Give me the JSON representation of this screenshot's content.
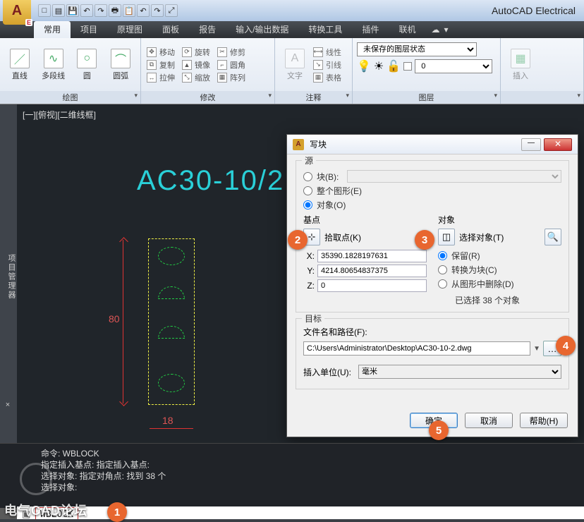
{
  "app": {
    "title": "AutoCAD Electrical"
  },
  "qat": [
    "□",
    "▦",
    "🖫",
    "↶",
    "↷",
    "🖶",
    "🗋",
    "↶",
    "↷",
    "⤢"
  ],
  "tabs": {
    "items": [
      "常用",
      "项目",
      "原理图",
      "面板",
      "报告",
      "输入/输出数据",
      "转换工具",
      "插件",
      "联机"
    ],
    "active_index": 0
  },
  "ribbon": {
    "draw": {
      "label": "绘图",
      "btns": [
        "直线",
        "多段线",
        "圆",
        "圆弧"
      ]
    },
    "modify": {
      "label": "修改",
      "items": [
        "移动",
        "旋转",
        "修剪",
        "复制",
        "镜像",
        "圆角",
        "拉伸",
        "缩放",
        "阵列"
      ]
    },
    "annot": {
      "label": "注释",
      "text_btn": "文字",
      "items": [
        "线性",
        "引线",
        "表格"
      ]
    },
    "layer": {
      "label": "图层",
      "state_label": "未保存的图层状态",
      "current": "0"
    },
    "insert": {
      "label": "插入"
    }
  },
  "canvas": {
    "view_label": "[一][俯视][二维线框]",
    "part_text": "AC30-10/2",
    "dim_v": "80",
    "dim_h": "18"
  },
  "sidebar": {
    "label": "项目管理器"
  },
  "dialog": {
    "title": "写块",
    "source": {
      "group": "源",
      "block": "块(B):",
      "entire": "整个图形(E)",
      "objects": "对象(O)"
    },
    "basepoint": {
      "group": "基点",
      "pick": "拾取点(K)",
      "x_label": "X:",
      "x": "35390.1828197631",
      "y_label": "Y:",
      "y": "4214.80654837375",
      "z_label": "Z:",
      "z": "0"
    },
    "objects": {
      "group": "对象",
      "select": "选择对象(T)",
      "retain": "保留(R)",
      "convert": "转换为块(C)",
      "delete": "从图形中删除(D)",
      "status": "已选择 38 个对象"
    },
    "target": {
      "group": "目标",
      "file_label": "文件名和路径(F):",
      "path": "C:\\Users\\Administrator\\Desktop\\AC30-10-2.dwg",
      "unit_label": "插入单位(U):",
      "unit": "毫米"
    },
    "buttons": {
      "ok": "确定",
      "cancel": "取消",
      "help": "帮助(H)"
    }
  },
  "command": {
    "lines": [
      "命令: WBLOCK",
      "指定插入基点: 指定插入基点:",
      "选择对象: 指定对角点: 找到 38 个",
      "选择对象:"
    ],
    "input": "WBLOCK"
  },
  "badges": {
    "1": "1",
    "2": "2",
    "3": "3",
    "4": "4",
    "5": "5"
  },
  "watermark": "电气CAD论坛"
}
